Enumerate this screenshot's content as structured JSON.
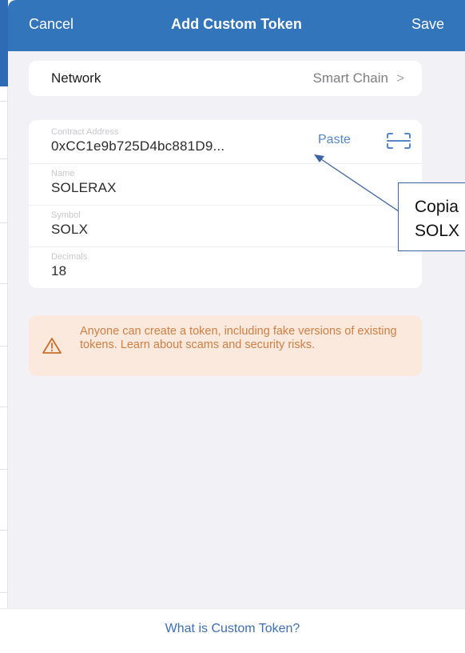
{
  "header": {
    "cancel_label": "Cancel",
    "title": "Add Custom Token",
    "save_label": "Save"
  },
  "network": {
    "label": "Network",
    "value": "Smart Chain",
    "chevron": ">"
  },
  "form": {
    "contract_address": {
      "label": "Contract Address",
      "value": "0xCC1e9b725D4bc881D9..."
    },
    "paste_label": "Paste",
    "scan_icon": "qr-scan-icon",
    "name": {
      "label": "Name",
      "value": "SOLERAX"
    },
    "symbol": {
      "label": "Symbol",
      "value": "SOLX"
    },
    "decimals": {
      "label": "Decimals",
      "value": "18"
    }
  },
  "warning": {
    "icon": "warning-triangle-icon",
    "text": "Anyone can create a token, including fake versions of existing tokens. Learn about scams and security risks."
  },
  "footer": {
    "link_label": "What is Custom Token?"
  },
  "annotation": {
    "line1": "Copia",
    "line2": "SOLX"
  },
  "colors": {
    "header_bg": "#3375bb",
    "sheet_bg": "#f2f2f6",
    "link": "#3d6fb3",
    "warning_bg": "#fbe9dd",
    "warning_text": "#cf7f43",
    "annotation_border": "#3d63a3"
  }
}
